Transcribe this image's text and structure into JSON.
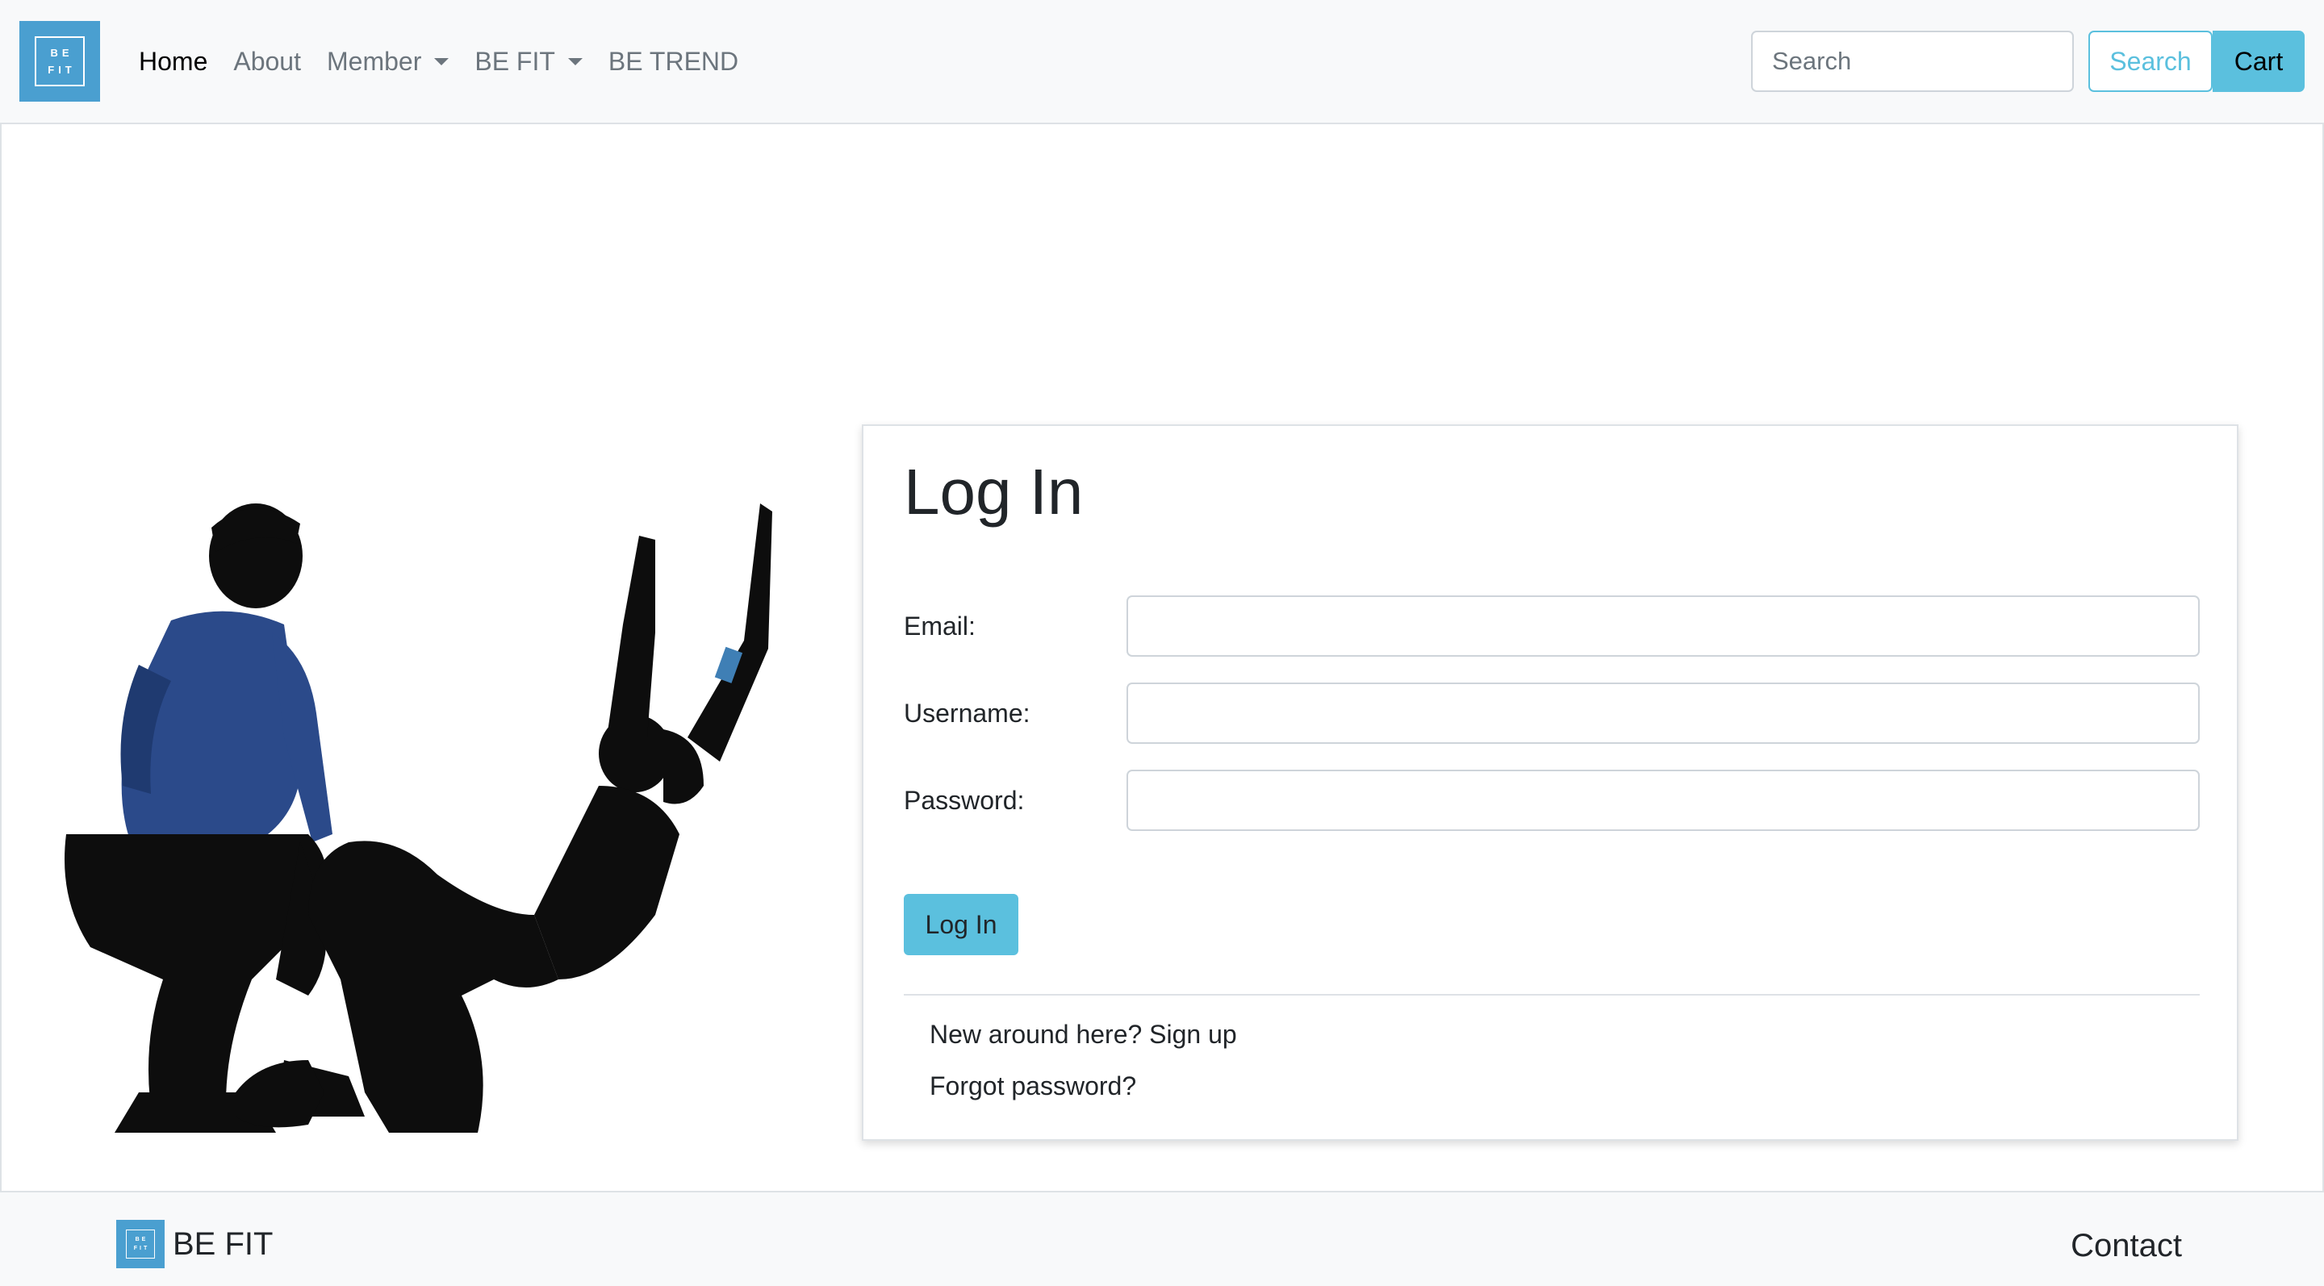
{
  "navbar": {
    "logo_top": "BE",
    "logo_bottom": "FIT",
    "links": [
      {
        "label": "Home"
      },
      {
        "label": "About"
      },
      {
        "label": "Member"
      },
      {
        "label": "BE FIT"
      },
      {
        "label": "BE TREND"
      }
    ],
    "search_placeholder": "Search",
    "search_button": "Search",
    "cart_button": "Cart"
  },
  "login": {
    "title": "Log In",
    "email_label": "Email:",
    "username_label": "Username:",
    "password_label": "Password:",
    "submit": "Log In",
    "signup_link": "New around here? Sign up",
    "forgot_link": "Forgot password?"
  },
  "footer": {
    "logo_top": "BE",
    "logo_bottom": "FIT",
    "brand": "BE FIT",
    "contact": "Contact"
  },
  "colors": {
    "accent": "#5bc0de",
    "logo_bg": "#4a9fd0",
    "navbar_bg": "#f8f9fa"
  }
}
